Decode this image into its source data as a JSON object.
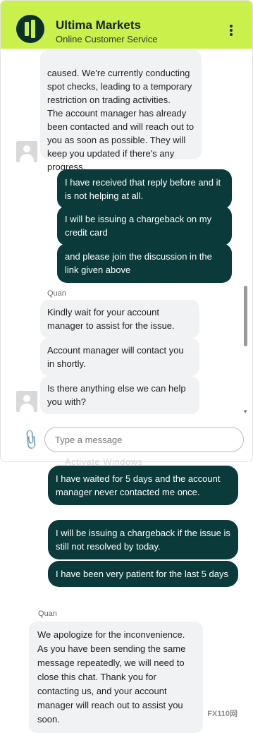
{
  "header": {
    "title": "Ultima Markets",
    "subtitle": "Online Customer Service"
  },
  "chat": {
    "agent_block_1": {
      "text": "caused. We're currently conducting spot checks, leading to a temporary restriction on trading activities.\nThe account manager has already been contacted and will reach out to you as soon as possible. They will keep you updated if there's any progress."
    },
    "user_messages_1": [
      "I have received that reply before and it is not helping at all.",
      "I will be issuing a chargeback on my credit card",
      "and please join the discussion in the link given above"
    ],
    "agent_name": "Quan",
    "agent_messages_2": [
      "Kindly wait for your account manager to assist for the issue.",
      "Account manager will contact you in shortly.",
      "Is there anything else we can help you with?"
    ],
    "input_placeholder": "Type a message"
  },
  "overlay_text": "Activate Windows",
  "continuation": {
    "user_messages": [
      "I have waited for 5 days and the account manager never contacted me once.",
      "I will be issuing a chargeback if the issue is still not resolved by today.",
      "I have been very patient for the last 5 days"
    ],
    "agent_name": "Quan",
    "agent_message": "We apologize for the inconvenience. As you have been sending the same message repeatedly, we will need to close this chat. Thank you for contacting us, and your account manager will reach out to assist you soon."
  },
  "footer_logo": "FX110网",
  "colors": {
    "header_bg": "#c9f04b",
    "user_bubble": "#0b3a3a",
    "agent_bubble": "#f1f2f4"
  }
}
